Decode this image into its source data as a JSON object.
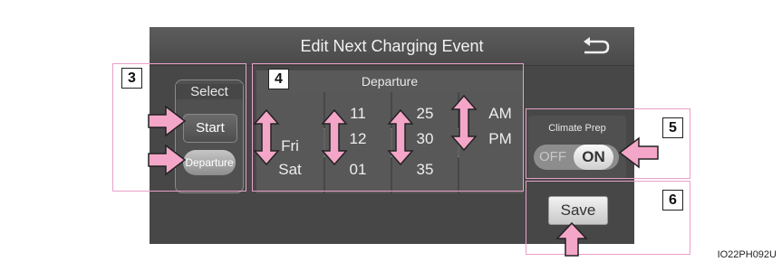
{
  "screen": {
    "title": "Edit Next Charging Event",
    "back_icon": "return-arrow-icon"
  },
  "select": {
    "label": "Select",
    "options": [
      "Start",
      "Departure"
    ],
    "selected": "Departure"
  },
  "departure": {
    "header": "Departure",
    "columns": [
      {
        "name": "day",
        "visible": [
          "Fri",
          "Sat"
        ],
        "selected": "Fri"
      },
      {
        "name": "hour",
        "visible": [
          "11",
          "12",
          "01"
        ],
        "selected": "12"
      },
      {
        "name": "minute",
        "visible": [
          "25",
          "30",
          "35"
        ],
        "selected": "30"
      },
      {
        "name": "ampm",
        "visible": [
          "AM",
          "PM"
        ],
        "selected": "PM"
      }
    ]
  },
  "climate": {
    "label": "Climate Prep",
    "off_label": "OFF",
    "on_label": "ON",
    "state": "ON"
  },
  "save_label": "Save",
  "callouts": [
    "3",
    "4",
    "5",
    "6"
  ],
  "image_id": "IO22PH092U",
  "colors": {
    "callout": "#e8a0c8",
    "arrow_fill": "#f4a6c8",
    "screen_bg": "#474747"
  }
}
